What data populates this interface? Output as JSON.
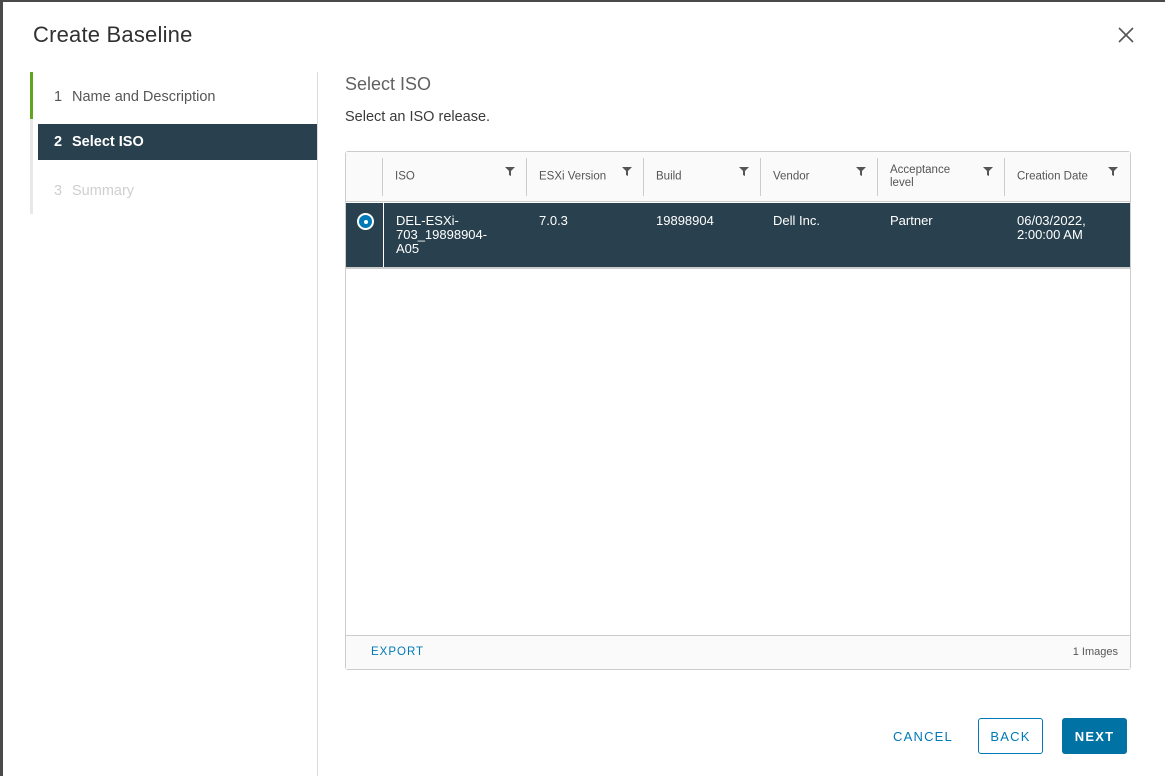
{
  "dialog": {
    "title": "Create Baseline"
  },
  "steps": [
    {
      "number": "1",
      "label": "Name and Description",
      "state": "completed"
    },
    {
      "number": "2",
      "label": "Select ISO",
      "state": "active"
    },
    {
      "number": "3",
      "label": "Summary",
      "state": "disabled"
    }
  ],
  "content": {
    "title": "Select ISO",
    "description": "Select an ISO release."
  },
  "grid": {
    "columns": [
      "ISO",
      "ESXi Version",
      "Build",
      "Vendor",
      "Acceptance level",
      "Creation Date"
    ],
    "rows": [
      {
        "selected": true,
        "iso": "DEL-ESXi-703_19898904-A05",
        "esxi_version": "7.0.3",
        "build": "19898904",
        "vendor": "Dell Inc.",
        "acceptance_level": "Partner",
        "creation_date": "06/03/2022, 2:00:00 AM"
      }
    ],
    "footer": {
      "export_label": "EXPORT",
      "count_text": "1 Images"
    }
  },
  "buttons": {
    "cancel": "CANCEL",
    "back": "BACK",
    "next": "NEXT"
  },
  "colors": {
    "accent": "#0079b8",
    "selected_row": "#29414e",
    "step_done": "#62a420"
  }
}
